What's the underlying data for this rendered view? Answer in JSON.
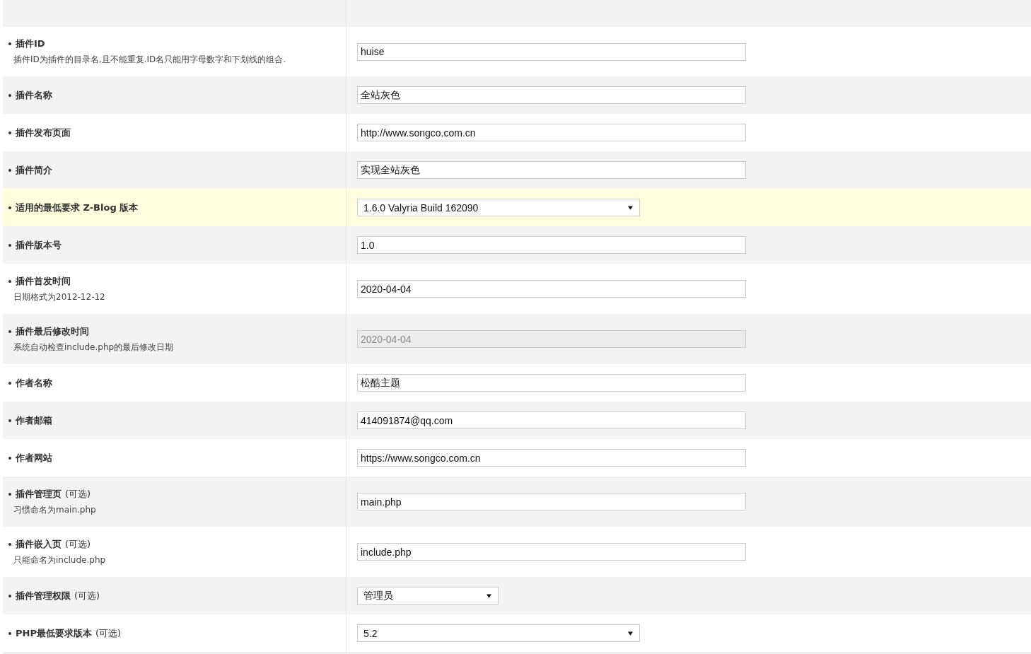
{
  "rows": [
    {
      "label": "插件ID",
      "hint": "插件ID为插件的目录名,且不能重复.ID名只能用字母数字和下划线的组合.",
      "highlighted": false,
      "field": {
        "kind": "text",
        "value": "huise",
        "disabled": false
      }
    },
    {
      "label": "插件名称",
      "highlighted": false,
      "field": {
        "kind": "text",
        "value": "全站灰色",
        "disabled": false
      }
    },
    {
      "label": "插件发布页面",
      "highlighted": false,
      "field": {
        "kind": "text",
        "value": "http://www.songco.com.cn",
        "disabled": false
      }
    },
    {
      "label": "插件简介",
      "highlighted": false,
      "field": {
        "kind": "text",
        "value": "实现全站灰色",
        "disabled": false
      }
    },
    {
      "label": "适用的最低要求 Z-Blog 版本",
      "highlighted": true,
      "field": {
        "kind": "select",
        "value": "1.6.0 Valyria Build 162090",
        "disabled": false
      }
    },
    {
      "label": "插件版本号",
      "highlighted": false,
      "field": {
        "kind": "text",
        "value": "1.0",
        "disabled": false
      }
    },
    {
      "label": "插件首发时间",
      "hint": "日期格式为2012-12-12",
      "highlighted": false,
      "field": {
        "kind": "text",
        "value": "2020-04-04",
        "disabled": false
      }
    },
    {
      "label": "插件最后修改时间",
      "hint": "系统自动检查include.php的最后修改日期",
      "highlighted": false,
      "field": {
        "kind": "text",
        "value": "2020-04-04",
        "disabled": true
      }
    },
    {
      "label": "作者名称",
      "highlighted": false,
      "field": {
        "kind": "text",
        "value": "松酷主题",
        "disabled": false
      }
    },
    {
      "label": "作者邮箱",
      "highlighted": false,
      "field": {
        "kind": "text",
        "value": "414091874@qq.com",
        "disabled": false
      }
    },
    {
      "label": "作者网站",
      "highlighted": false,
      "field": {
        "kind": "text",
        "value": "https://www.songco.com.cn",
        "disabled": false
      }
    },
    {
      "label": "插件管理页",
      "suffix": "(可选)",
      "hint": "习惯命名为main.php",
      "highlighted": false,
      "field": {
        "kind": "text",
        "value": "main.php",
        "disabled": false
      }
    },
    {
      "label": "插件嵌入页",
      "suffix": "(可选)",
      "hint": "只能命名为include.php",
      "highlighted": false,
      "field": {
        "kind": "text",
        "value": "include.php",
        "disabled": false
      }
    },
    {
      "label": "插件管理权限",
      "suffix": "(可选)",
      "highlighted": false,
      "field": {
        "kind": "narrow-select",
        "value": "管理员",
        "disabled": false
      }
    },
    {
      "label": "PHP最低要求版本",
      "suffix": "(可选)",
      "highlighted": false,
      "field": {
        "kind": "select",
        "value": "5.2",
        "disabled": false
      }
    }
  ]
}
